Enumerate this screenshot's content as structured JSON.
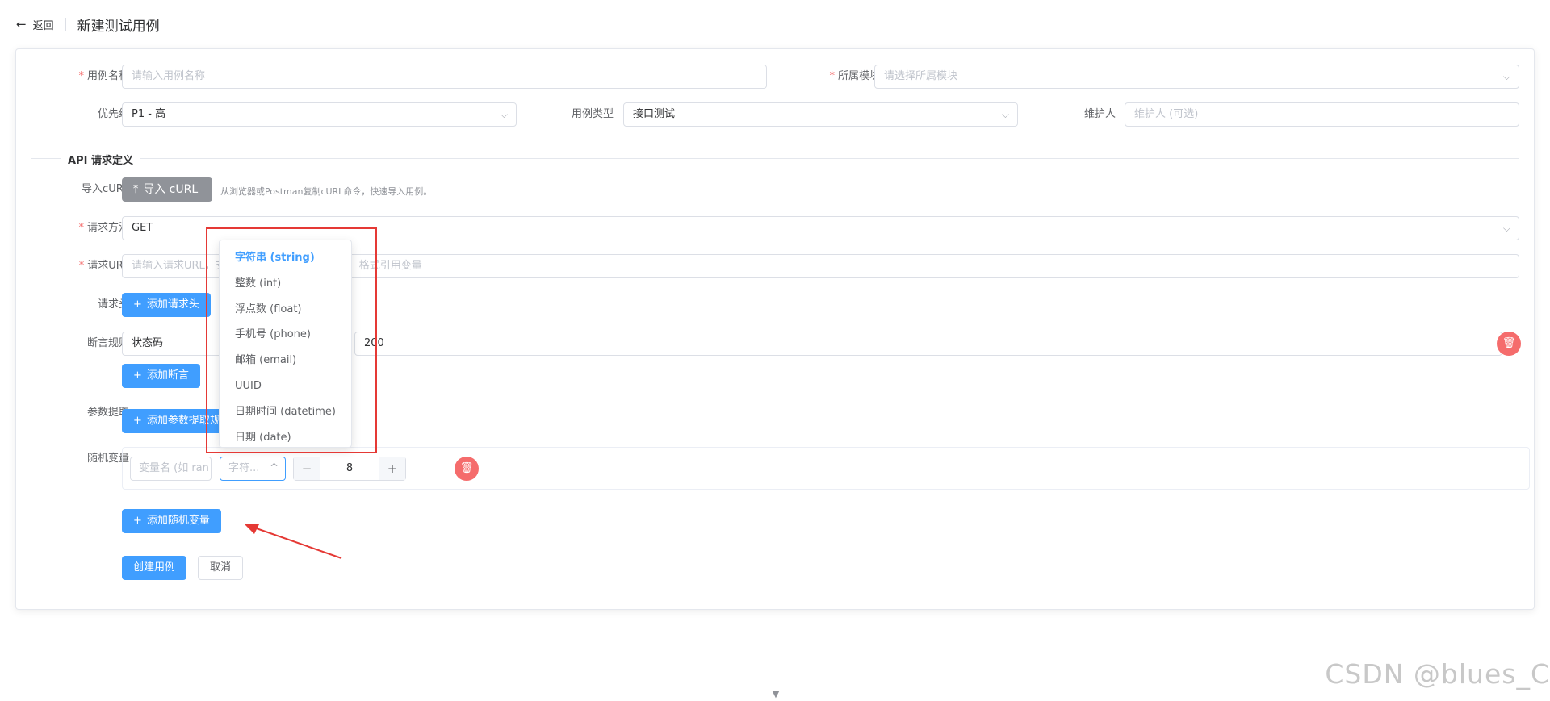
{
  "header": {
    "back_label": "返回",
    "title": "新建测试用例"
  },
  "form": {
    "case_name": {
      "label": "用例名称",
      "placeholder": "请输入用例名称"
    },
    "module": {
      "label": "所属模块",
      "placeholder": "请选择所属模块"
    },
    "priority": {
      "label": "优先级",
      "value": "P1 - 高"
    },
    "case_type": {
      "label": "用例类型",
      "value": "接口测试"
    },
    "maintainer": {
      "label": "维护人",
      "placeholder": "维护人 (可选)"
    }
  },
  "api_section": {
    "title": "API 请求定义",
    "import_curl": {
      "label": "导入cURL",
      "button": "导入 cURL",
      "hint": "从浏览器或Postman复制cURL命令，快速导入用例。"
    },
    "method": {
      "label": "请求方法",
      "value": "GET"
    },
    "url": {
      "label": "请求URL",
      "placeholder_left": "请输入请求URL，支",
      "placeholder_right": "格式引用变量"
    },
    "headers": {
      "label": "请求头",
      "button": "添加请求头"
    },
    "assertions": {
      "label": "断言规则",
      "type_value": "状态码",
      "expected_value": "200",
      "button": "添加断言"
    },
    "extract": {
      "label": "参数提取",
      "button": "添加参数提取规"
    },
    "random_vars": {
      "label": "随机变量",
      "name_placeholder": "变量名 (如 ran",
      "type_placeholder": "字符...",
      "length_value": "8",
      "button": "添加随机变量"
    }
  },
  "type_dropdown": {
    "options": [
      "字符串 (string)",
      "整数 (int)",
      "浮点数 (float)",
      "手机号 (phone)",
      "邮箱 (email)",
      "UUID",
      "日期时间 (datetime)",
      "日期 (date)"
    ],
    "selected_index": 0
  },
  "actions": {
    "create": "创建用例",
    "cancel": "取消"
  },
  "watermark": "CSDN @blues_C",
  "colors": {
    "primary": "#409eff",
    "danger": "#f56c6c",
    "annotation": "#e53935"
  }
}
